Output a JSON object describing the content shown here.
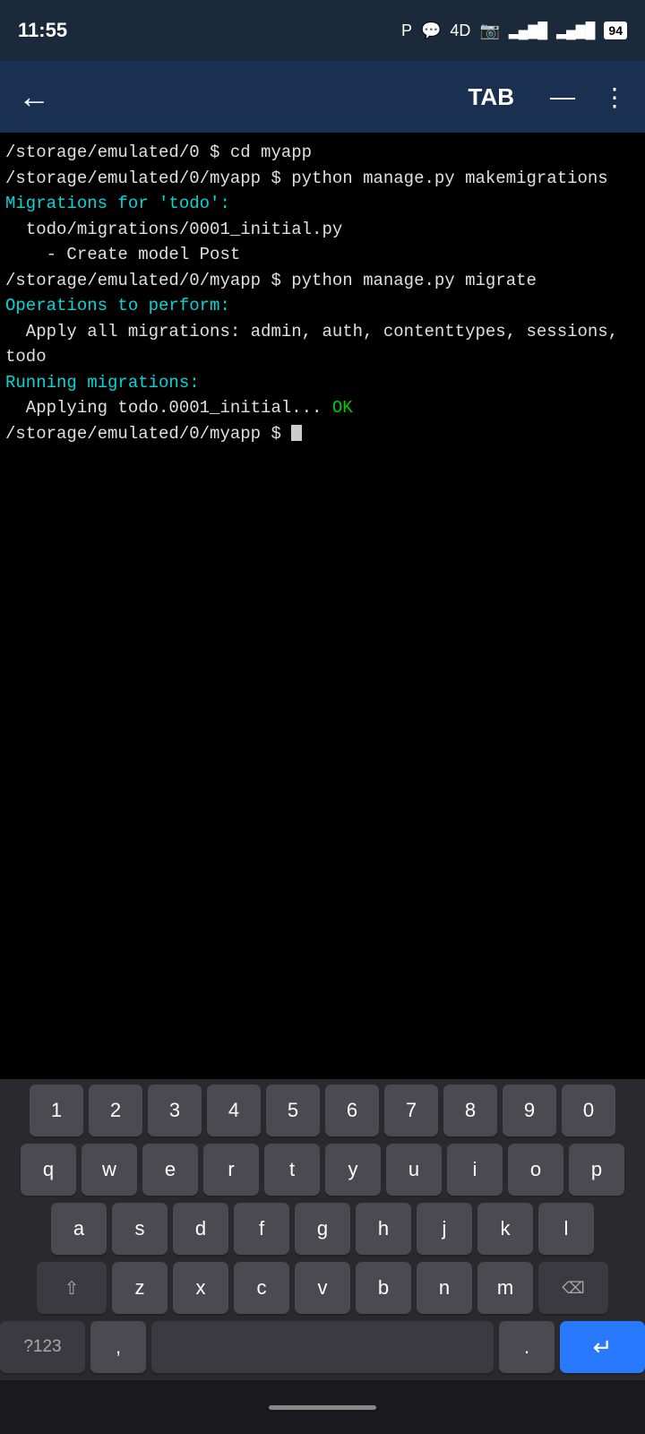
{
  "statusBar": {
    "time": "11:55",
    "batteryLevel": "94",
    "icons": [
      "P",
      "💬",
      "4D",
      "📷"
    ]
  },
  "navBar": {
    "tabLabel": "TAB",
    "minimizeLabel": "—",
    "moreLabel": "⋮"
  },
  "terminal": {
    "lines": [
      {
        "text": "/storage/emulated/0 $ cd myapp",
        "color": "white"
      },
      {
        "text": "/storage/emulated/0/myapp $ python manage.py makemigrations",
        "color": "white"
      },
      {
        "text": "Migrations for 'todo':",
        "color": "cyan"
      },
      {
        "text": "  todo/migrations/0001_initial.py",
        "color": "white"
      },
      {
        "text": "    - Create model Post",
        "color": "white"
      },
      {
        "text": "/storage/emulated/0/myapp $ python manage.py migrate",
        "color": "white"
      },
      {
        "text": "Operations to perform:",
        "color": "cyan"
      },
      {
        "text": "  Apply all migrations: admin, auth, contenttypes, sessions,",
        "color": "white"
      },
      {
        "text": "todo",
        "color": "white"
      },
      {
        "text": "Running migrations:",
        "color": "cyan"
      },
      {
        "text": "  Applying todo.0001_initial... ",
        "color": "white",
        "suffix": "OK",
        "suffixColor": "green"
      },
      {
        "text": "/storage/emulated/0/myapp $ ",
        "color": "white",
        "cursor": true
      }
    ]
  },
  "keyboard": {
    "row1": [
      "1",
      "2",
      "3",
      "4",
      "5",
      "6",
      "7",
      "8",
      "9",
      "0"
    ],
    "row2": [
      "q",
      "w",
      "e",
      "r",
      "t",
      "y",
      "u",
      "i",
      "o",
      "p"
    ],
    "row3": [
      "a",
      "s",
      "d",
      "f",
      "g",
      "h",
      "j",
      "k",
      "l"
    ],
    "row4": [
      "z",
      "x",
      "c",
      "v",
      "b",
      "n",
      "m"
    ],
    "symbols": "?123",
    "comma": ",",
    "period": ".",
    "enterIcon": "↵"
  },
  "bottomBar": {
    "homeIndicator": ""
  }
}
